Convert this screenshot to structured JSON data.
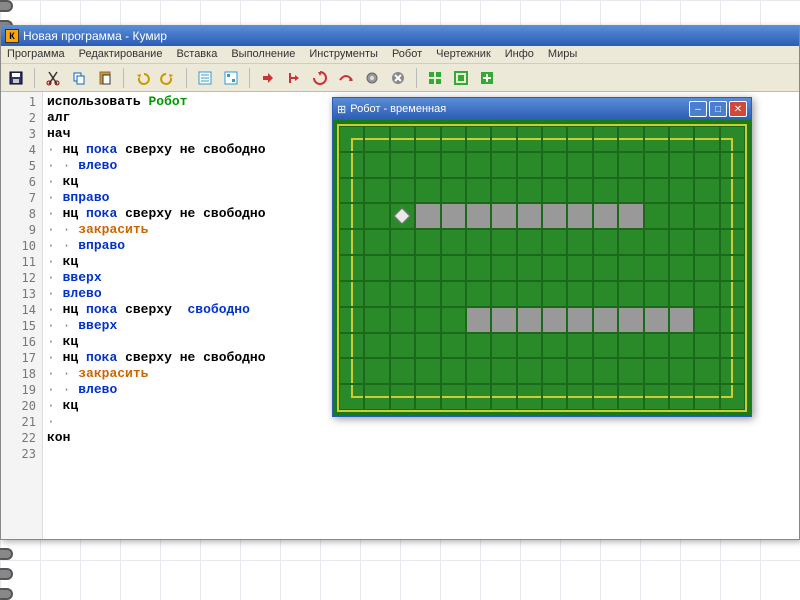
{
  "app": {
    "title": "Новая программа - Кумир",
    "icon_letter": "К"
  },
  "menu": {
    "program": "Программа",
    "edit": "Редактирование",
    "insert": "Вставка",
    "run": "Выполнение",
    "tools": "Инструменты",
    "robot": "Робот",
    "drafter": "Чертежник",
    "info": "Инфо",
    "worlds": "Миры"
  },
  "code": {
    "lines": 23,
    "l1_use": "использовать",
    "l1_robot": "Робот",
    "l2": "алг",
    "l3": "нач",
    "nc": "нц",
    "poka": "пока",
    "sverhu": "сверху",
    "ne": "не",
    "svobodno": "свободно",
    "vlevo": "влево",
    "kc": "кц",
    "vpravo": "вправо",
    "zakrasit": "закрасить",
    "vverh": "вверх",
    "kon": "кон",
    "dot": "·"
  },
  "robot_win": {
    "title": "Робот - временная",
    "icon": "⊞"
  },
  "field": {
    "cols": 16,
    "rows": 11,
    "robot": {
      "r": 3,
      "c": 2
    },
    "walls": [
      {
        "r": 3,
        "c": 3
      },
      {
        "r": 3,
        "c": 4
      },
      {
        "r": 3,
        "c": 5
      },
      {
        "r": 3,
        "c": 6
      },
      {
        "r": 3,
        "c": 7
      },
      {
        "r": 3,
        "c": 8
      },
      {
        "r": 3,
        "c": 9
      },
      {
        "r": 3,
        "c": 10
      },
      {
        "r": 3,
        "c": 11
      },
      {
        "r": 7,
        "c": 5
      },
      {
        "r": 7,
        "c": 6
      },
      {
        "r": 7,
        "c": 7
      },
      {
        "r": 7,
        "c": 8
      },
      {
        "r": 7,
        "c": 9
      },
      {
        "r": 7,
        "c": 10
      },
      {
        "r": 7,
        "c": 11
      },
      {
        "r": 7,
        "c": 12
      },
      {
        "r": 7,
        "c": 13
      }
    ]
  }
}
